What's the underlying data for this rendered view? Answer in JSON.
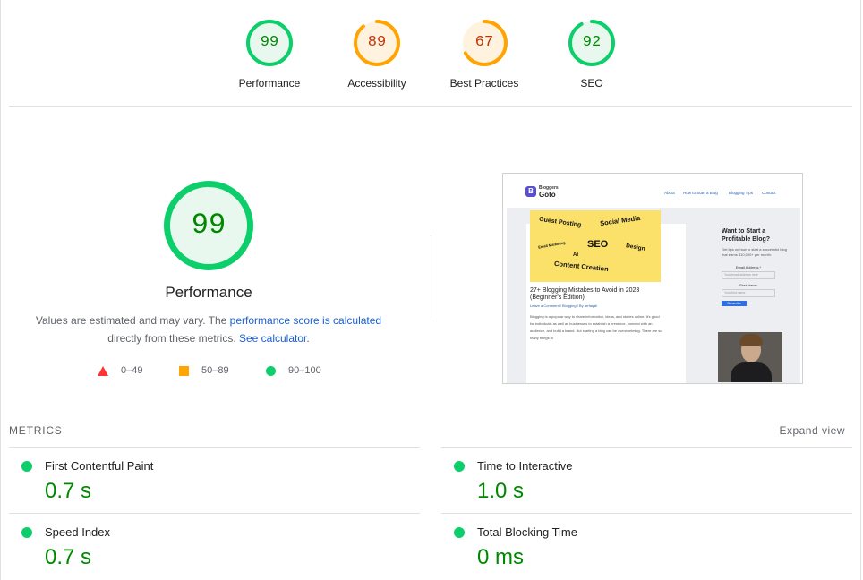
{
  "gauges": [
    {
      "score": "99",
      "label": "Performance",
      "level": 0.99,
      "color": "#0cce6b",
      "text_color": "#008800",
      "fill": "#e8f8ee"
    },
    {
      "score": "89",
      "label": "Accessibility",
      "level": 0.89,
      "color": "#ffa400",
      "text_color": "#c33300",
      "fill": "#fff3e0"
    },
    {
      "score": "67",
      "label": "Best Practices",
      "level": 0.67,
      "color": "#ffa400",
      "text_color": "#c33300",
      "fill": "#fff3e0"
    },
    {
      "score": "92",
      "label": "SEO",
      "level": 0.92,
      "color": "#0cce6b",
      "text_color": "#008800",
      "fill": "#e8f8ee"
    }
  ],
  "performance": {
    "score": "99",
    "level": 0.99,
    "title": "Performance",
    "desc_prefix": "Values are estimated and may vary. The ",
    "desc_link1": "performance score is calculated",
    "desc_middle": "directly from these metrics. ",
    "desc_link2": "See calculator",
    "desc_suffix": "."
  },
  "legend": {
    "fail": "0–49",
    "average": "50–89",
    "pass": "90–100"
  },
  "screenshot": {
    "logo_top": "Bloggers",
    "logo_bottom": "Goto",
    "nav": [
      "About",
      "How to Start a Blog",
      "Blogging Tips",
      "Contact"
    ],
    "banner_words": [
      "Guest Posting",
      "Social Media",
      "Email Marketing",
      "SEO",
      "Design",
      "AI",
      "Content Creation"
    ],
    "post_title": "27+ Blogging Mistakes to Avoid in 2023 (Beginner's Edition)",
    "post_meta": "Leave a Comment / Blogging / By arrfaqali",
    "post_text": "Blogging is a popular way to share information, ideas, and stories online. It's good for individuals as well as businesses to establish a presence, connect with an audience, and build a brand. But starting a blog can be overwhelming. There are so many things to",
    "sidebar_heading": "Want to Start a Profitable Blog?",
    "sidebar_text": "Get tips on how to start a successful blog that earns $10,000+ per month.",
    "email_label": "Email Address *",
    "email_placeholder": "Your email address here",
    "first_name_label": "First Name",
    "first_name_placeholder": "Your first name",
    "subscribe": "Subscribe"
  },
  "metrics": {
    "header": "METRICS",
    "expand": "Expand view",
    "items": [
      {
        "name": "First Contentful Paint",
        "value": "0.7 s"
      },
      {
        "name": "Time to Interactive",
        "value": "1.0 s"
      },
      {
        "name": "Speed Index",
        "value": "0.7 s"
      },
      {
        "name": "Total Blocking Time",
        "value": "0 ms"
      }
    ]
  },
  "colors": {
    "pass": "#0cce6b",
    "average": "#ffa400",
    "fail": "#ff3333",
    "pass_text": "#008800",
    "link": "#1a5fd0"
  }
}
